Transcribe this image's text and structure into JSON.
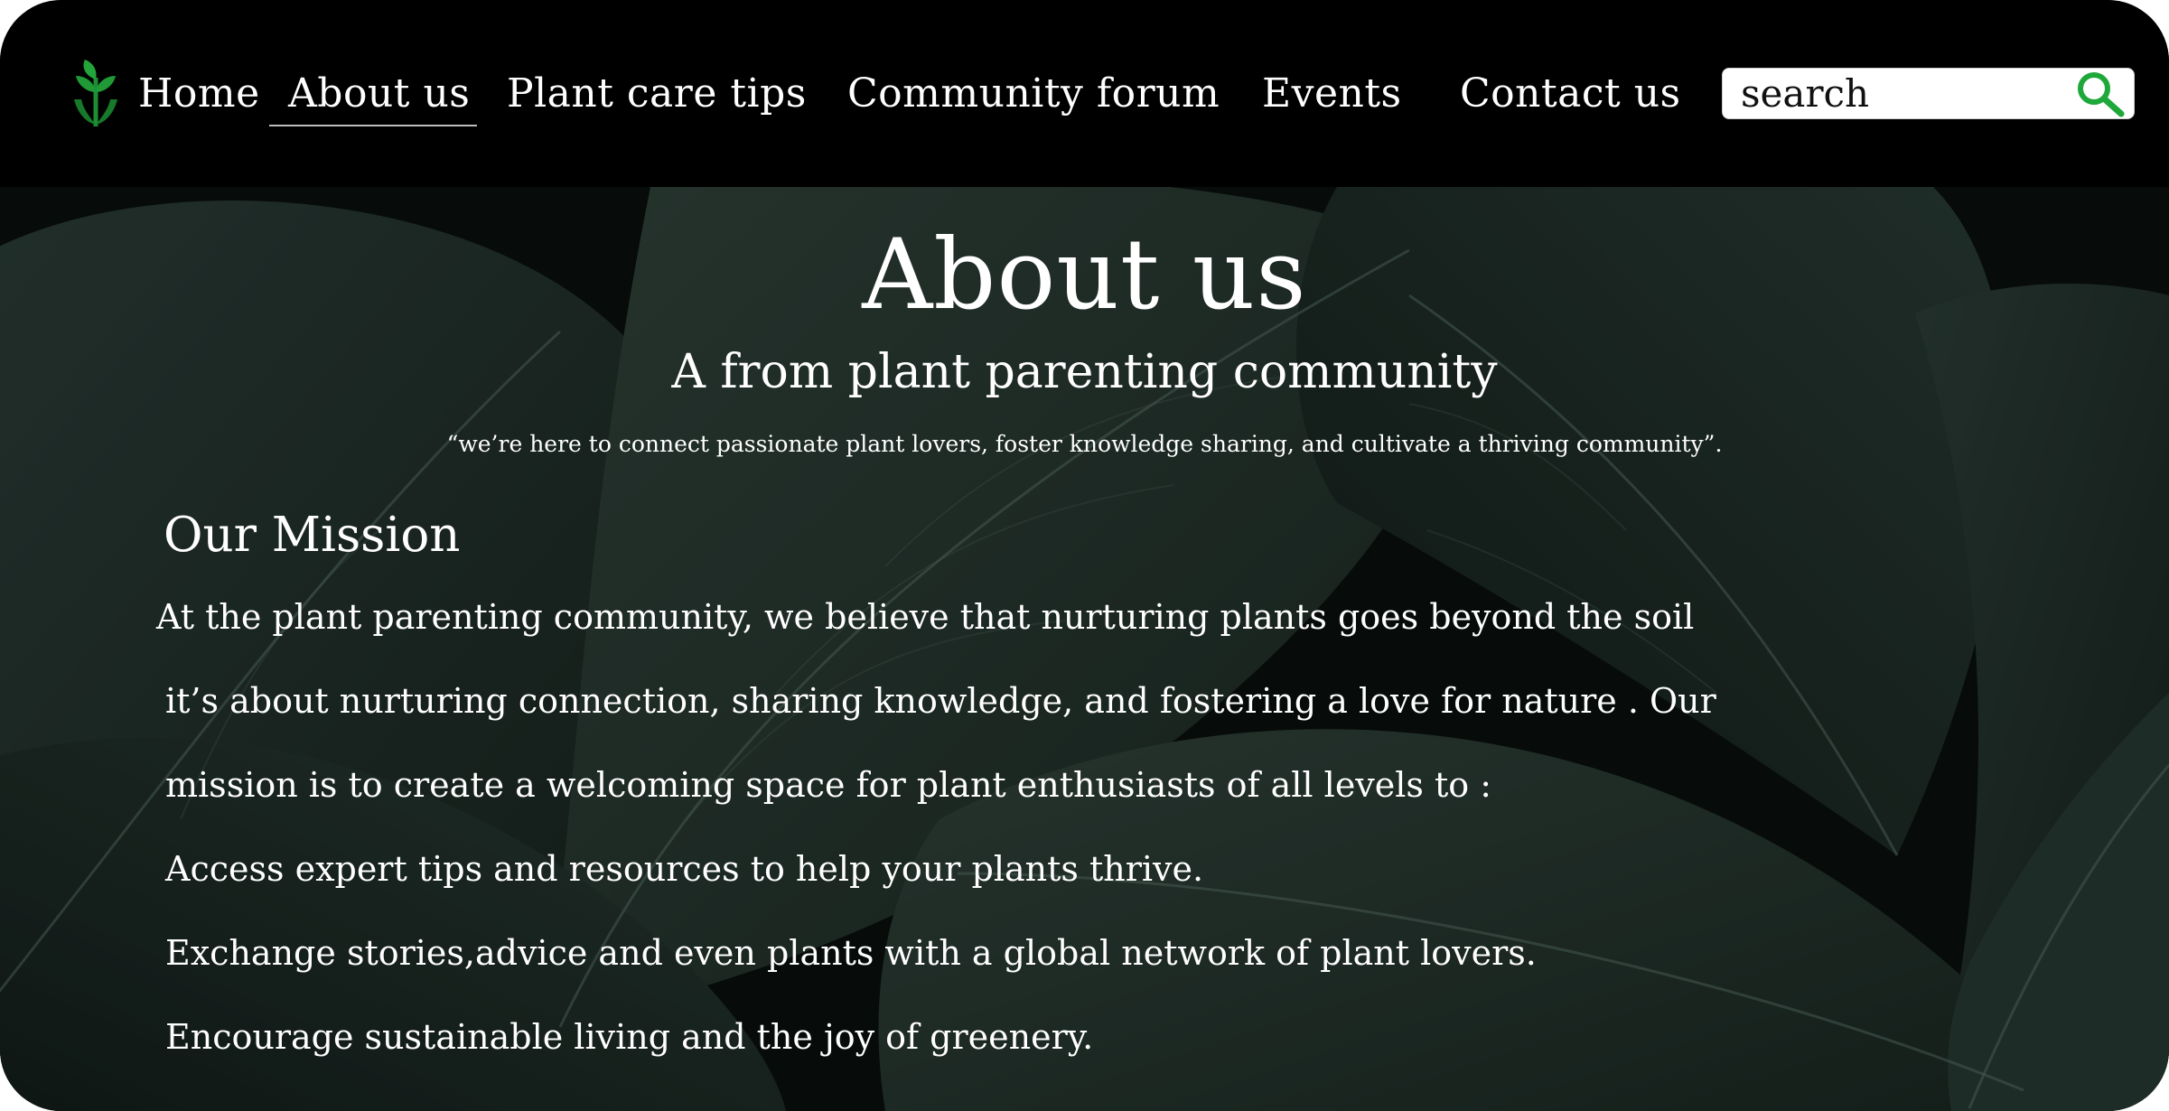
{
  "nav": {
    "items": [
      {
        "label": "Home"
      },
      {
        "label": "About us",
        "active": true
      },
      {
        "label": "Plant care tips"
      },
      {
        "label": "Community forum"
      },
      {
        "label": "Events"
      },
      {
        "label": "Contact us"
      }
    ],
    "search_placeholder": "search"
  },
  "hero": {
    "title": "About us",
    "subtitle": "A from plant parenting community",
    "quote": "“we’re here to connect passionate plant lovers, foster knowledge sharing, and cultivate a thriving community”."
  },
  "mission": {
    "heading": "Our Mission",
    "lines": [
      "At the plant parenting community, we believe that nurturing plants goes beyond the soil",
      "it’s about nurturing connection, sharing knowledge, and fostering a love for nature . Our",
      "mission is to create a welcoming space for plant enthusiasts of all levels to :",
      "Access expert tips and resources to help your plants thrive.",
      "Exchange stories,advice and even plants with a global network of plant lovers.",
      "Encourage sustainable living and the joy of greenery."
    ]
  },
  "colors": {
    "nav_background": "#000000",
    "accent_green": "#1fa83a",
    "leaf_dark": "#1b2a26",
    "text": "#ffffff"
  },
  "icons": {
    "logo": "sprout-hands-logo",
    "search": "magnifier-icon"
  }
}
